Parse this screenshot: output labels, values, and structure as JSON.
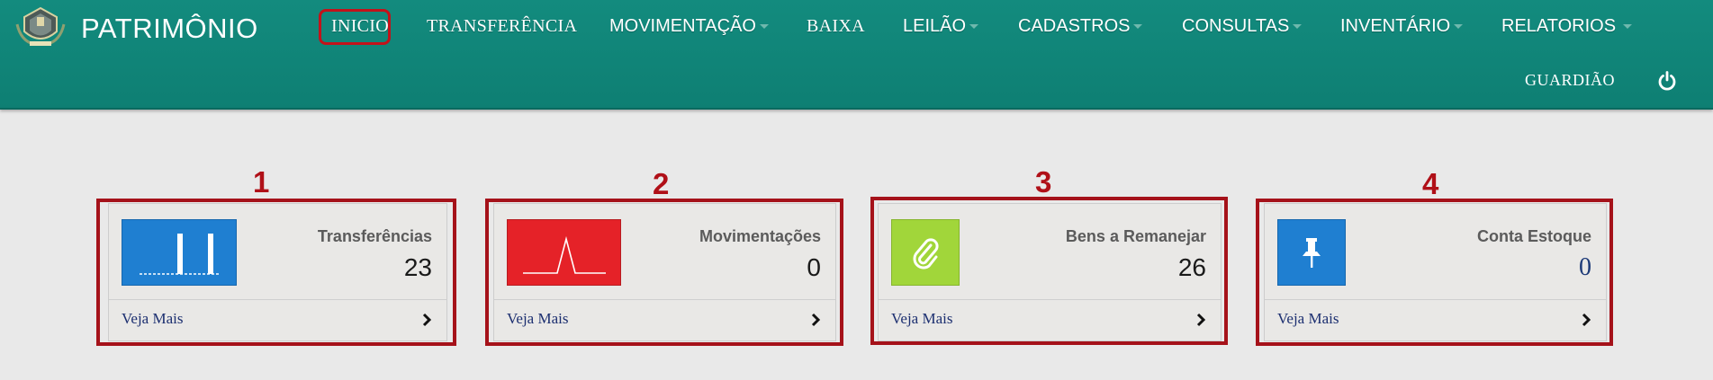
{
  "app": {
    "title": "PATRIMÔNIO"
  },
  "nav": {
    "inicio": "INICIO",
    "transferencia": "TRANSFERÊNCIA",
    "movimentacao": "MOVIMENTAÇÃO",
    "baixa": "BAIXA",
    "leilao": "LEILÃO",
    "cadastros": "CADASTROS",
    "consultas": "CONSULTAS",
    "inventario": "INVENTÁRIO",
    "relatorios": "RELATORIOS",
    "user": "GUARDIÃO"
  },
  "icons": {
    "logo": "municipal-coat-of-arms-icon",
    "power": "power-icon",
    "transferencias": "bar-chart-icon",
    "movimentacoes": "pulse-line-icon",
    "bens": "paperclip-icon",
    "estoque": "pushpin-icon",
    "chevron": "chevron-right-icon"
  },
  "annotations": [
    "1",
    "2",
    "3",
    "4"
  ],
  "cards": [
    {
      "title": "Transferências",
      "value": "23",
      "link": "Veja Mais",
      "color": "#1f7fd1"
    },
    {
      "title": "Movimentações",
      "value": "0",
      "link": "Veja Mais",
      "color": "#e52228"
    },
    {
      "title": "Bens a Remanejar",
      "value": "26",
      "link": "Veja Mais",
      "color": "#a1d63a"
    },
    {
      "title": "Conta Estoque",
      "value": "0",
      "link": "Veja Mais",
      "color": "#1f7fd1"
    }
  ],
  "colors": {
    "navbar": "#138b7e",
    "annotation": "#a5121a",
    "link": "#1c2f70"
  }
}
